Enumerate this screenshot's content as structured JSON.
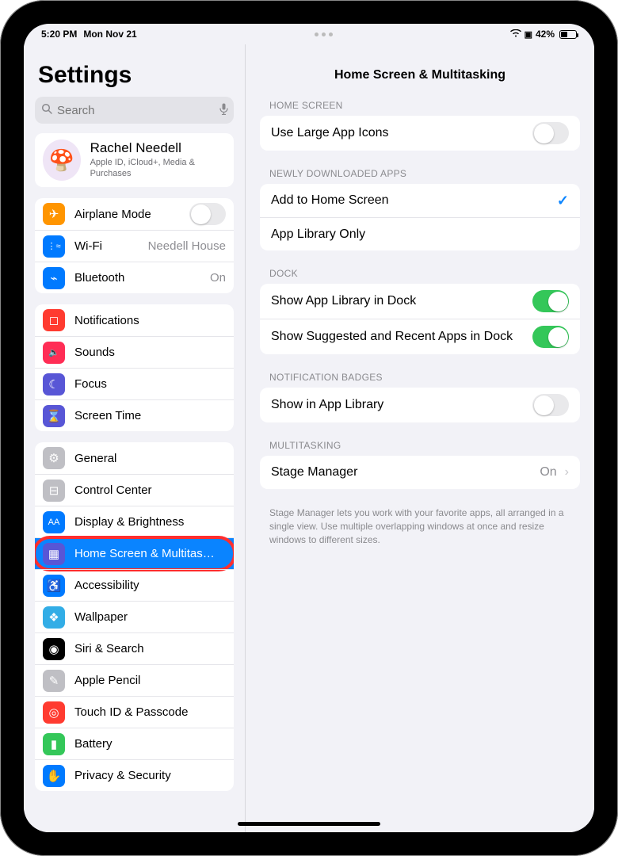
{
  "status": {
    "time": "5:20 PM",
    "date": "Mon Nov 21",
    "battery": "42%"
  },
  "sidebar": {
    "title": "Settings",
    "searchPlaceholder": "Search",
    "account": {
      "name": "Rachel Needell",
      "sub": "Apple ID, iCloud+, Media & Purchases"
    },
    "g1": [
      {
        "label": "Airplane Mode",
        "iconBg": "bg-orange",
        "glyph": "✈",
        "toggle": false
      },
      {
        "label": "Wi-Fi",
        "value": "Needell House",
        "iconBg": "bg-blue",
        "glyph": "⋮≈"
      },
      {
        "label": "Bluetooth",
        "value": "On",
        "iconBg": "bg-bt",
        "glyph": "⌁"
      }
    ],
    "g2": [
      {
        "label": "Notifications",
        "iconBg": "bg-red",
        "glyph": "◻"
      },
      {
        "label": "Sounds",
        "iconBg": "bg-pink",
        "glyph": "🔈"
      },
      {
        "label": "Focus",
        "iconBg": "bg-indigo",
        "glyph": "☾"
      },
      {
        "label": "Screen Time",
        "iconBg": "bg-indigo",
        "glyph": "⌛"
      }
    ],
    "g3": [
      {
        "label": "General",
        "iconBg": "bg-grayL",
        "glyph": "⚙"
      },
      {
        "label": "Control Center",
        "iconBg": "bg-grayL",
        "glyph": "⊟"
      },
      {
        "label": "Display & Brightness",
        "iconBg": "bg-blue",
        "glyph": "AA"
      },
      {
        "label": "Home Screen & Multitas…",
        "iconBg": "bg-grid",
        "glyph": "▦",
        "selected": true,
        "highlight": true
      },
      {
        "label": "Accessibility",
        "iconBg": "bg-blue",
        "glyph": "♿"
      },
      {
        "label": "Wallpaper",
        "iconBg": "bg-cyan",
        "glyph": "❖"
      },
      {
        "label": "Siri & Search",
        "iconBg": "bg-black",
        "glyph": "◉"
      },
      {
        "label": "Apple Pencil",
        "iconBg": "bg-grayL",
        "glyph": "✎"
      },
      {
        "label": "Touch ID & Passcode",
        "iconBg": "bg-redf",
        "glyph": "◎"
      },
      {
        "label": "Battery",
        "iconBg": "bg-green",
        "glyph": "▮"
      },
      {
        "label": "Privacy & Security",
        "iconBg": "bg-lblue",
        "glyph": "✋"
      }
    ]
  },
  "detail": {
    "title": "Home Screen & Multitasking",
    "sections": [
      {
        "header": "HOME SCREEN",
        "rows": [
          {
            "label": "Use Large App Icons",
            "toggle": false
          }
        ]
      },
      {
        "header": "NEWLY DOWNLOADED APPS",
        "rows": [
          {
            "label": "Add to Home Screen",
            "checked": true
          },
          {
            "label": "App Library Only"
          }
        ]
      },
      {
        "header": "DOCK",
        "rows": [
          {
            "label": "Show App Library in Dock",
            "toggle": true
          },
          {
            "label": "Show Suggested and Recent Apps in Dock",
            "toggle": true
          }
        ]
      },
      {
        "header": "NOTIFICATION BADGES",
        "rows": [
          {
            "label": "Show in App Library",
            "toggle": false
          }
        ]
      },
      {
        "header": "MULTITASKING",
        "rows": [
          {
            "label": "Stage Manager",
            "value": "On",
            "chevron": true
          }
        ],
        "footer": "Stage Manager lets you work with your favorite apps, all arranged in a single view. Use multiple overlapping windows at once and resize windows to different sizes."
      }
    ]
  }
}
